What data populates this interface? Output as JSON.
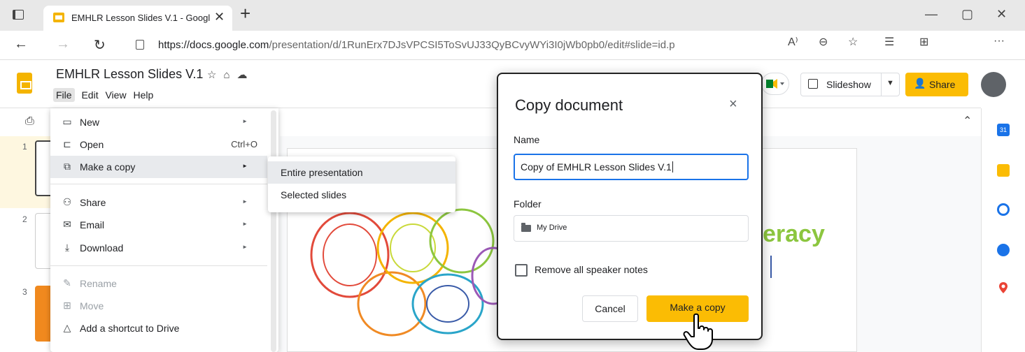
{
  "browser": {
    "tab_title": "EMHLR Lesson Slides V.1 - Googl",
    "tab_close": "✕",
    "new_tab": "+",
    "url_host": "https://docs.google.com",
    "url_path": "/presentation/d/1RunErx7DJsVPCSI5ToSvUJ33QyBCvyWYi3I0jWb0pb0/edit#slide=id.p",
    "window_controls": {
      "minimize": "—",
      "maximize": "▢",
      "close": "✕"
    },
    "read_aloud": "A⁾",
    "more": "···"
  },
  "app": {
    "doc_title": "EMHLR Lesson Slides V.1",
    "menus": [
      "File",
      "Edit",
      "View",
      "Help"
    ],
    "slideshow_label": "Slideshow",
    "share_label": "Share",
    "accent_color": "#fbbc04"
  },
  "filmstrip": {
    "numbers": [
      "1",
      "2",
      "3"
    ]
  },
  "slide": {
    "visible_text": "eracy"
  },
  "file_menu": {
    "items": [
      {
        "label": "New",
        "icon": "new-icon",
        "shortcut": "",
        "has_submenu": true,
        "disabled": false
      },
      {
        "label": "Open",
        "icon": "folder-icon",
        "shortcut": "Ctrl+O",
        "has_submenu": false,
        "disabled": false
      },
      {
        "label": "Make a copy",
        "icon": "copy-icon",
        "shortcut": "",
        "has_submenu": true,
        "disabled": false
      },
      {
        "label": "Share",
        "icon": "person-add-icon",
        "shortcut": "",
        "has_submenu": true,
        "disabled": false
      },
      {
        "label": "Email",
        "icon": "email-icon",
        "shortcut": "",
        "has_submenu": true,
        "disabled": false
      },
      {
        "label": "Download",
        "icon": "download-icon",
        "shortcut": "",
        "has_submenu": true,
        "disabled": false
      },
      {
        "label": "Rename",
        "icon": "rename-icon",
        "shortcut": "",
        "has_submenu": false,
        "disabled": true
      },
      {
        "label": "Move",
        "icon": "move-icon",
        "shortcut": "",
        "has_submenu": false,
        "disabled": true
      },
      {
        "label": "Add a shortcut to Drive",
        "icon": "drive-shortcut-icon",
        "shortcut": "",
        "has_submenu": false,
        "disabled": false
      }
    ],
    "submenu_arrow": "►",
    "highlighted": "Make a copy"
  },
  "copy_submenu": {
    "items": [
      "Entire presentation",
      "Selected slides"
    ],
    "highlighted": "Entire presentation"
  },
  "dialog": {
    "title": "Copy document",
    "close": "×",
    "name_label": "Name",
    "name_value": "Copy of EMHLR Lesson Slides V.1",
    "folder_label": "Folder",
    "folder_value": "My Drive",
    "remove_notes_label": "Remove all speaker notes",
    "remove_notes_checked": false,
    "cancel_label": "Cancel",
    "confirm_label": "Make a copy"
  }
}
